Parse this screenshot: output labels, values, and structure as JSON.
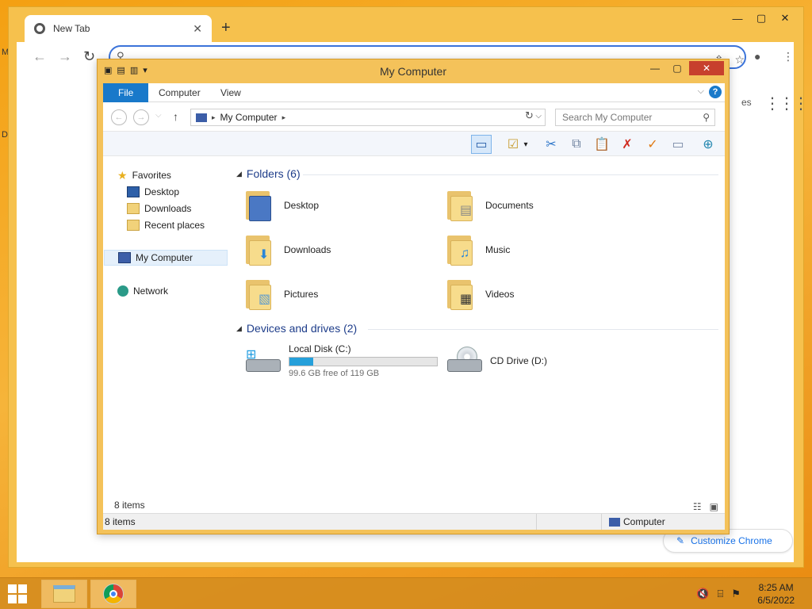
{
  "desktop": {
    "frag_m": "M",
    "frag_d": "D"
  },
  "chrome": {
    "tab_title": "New Tab",
    "tab_close": "✕",
    "new_tab": "+",
    "controls": [
      "—",
      "▢",
      "✕"
    ],
    "nav": {
      "back": "←",
      "forward": "→",
      "reload": "↻"
    },
    "omnibox_icons": [
      "⇪",
      "☆",
      "●",
      "⋮"
    ],
    "search_icon": "⚲",
    "content_fragment": "es",
    "apps_icon": "⋮⋮⋮",
    "customize_label": "Customize Chrome",
    "customize_icon": "✎"
  },
  "explorer": {
    "title": "My Computer",
    "quick_access": [
      "▣",
      "▤",
      "▥",
      "▾"
    ],
    "controls": {
      "minimize": "—",
      "maximize": "▢",
      "close": "✕"
    },
    "ribbon": {
      "tabs": [
        "File",
        "Computer",
        "View"
      ],
      "collapse": "⌵",
      "help": "?"
    },
    "address": {
      "back": "←",
      "forward": "→",
      "recent": "⌵",
      "up": "↑",
      "breadcrumb": "My Computer",
      "arrow": "▸",
      "dropdown": "⌵",
      "refresh": "↻",
      "search_placeholder": "Search My Computer",
      "search_icon": "⚲"
    },
    "commands": [
      "▭",
      "☑",
      "▾",
      "✂",
      "⧉",
      "📋",
      "✗",
      "✓",
      "▭",
      "⊕"
    ],
    "nav": {
      "favorites": "Favorites",
      "desktop": "Desktop",
      "downloads": "Downloads",
      "recent": "Recent places",
      "computer": "My Computer",
      "network": "Network"
    },
    "groups": {
      "folders": "Folders (6)",
      "devices": "Devices and drives (2)"
    },
    "folders": [
      {
        "name": "Desktop",
        "overlay": "▬"
      },
      {
        "name": "Documents",
        "overlay": "▤"
      },
      {
        "name": "Downloads",
        "overlay": "⬇"
      },
      {
        "name": "Music",
        "overlay": "♫"
      },
      {
        "name": "Pictures",
        "overlay": "▧"
      },
      {
        "name": "Videos",
        "overlay": "▦"
      }
    ],
    "drives": [
      {
        "name": "Local Disk (C:)",
        "free": "99.6 GB free of 119 GB",
        "used_fraction": 0.163
      },
      {
        "name": "CD Drive (D:)"
      }
    ],
    "status": {
      "items_inner": "8 items",
      "items_outer": "8 items",
      "location": "Computer",
      "view_icons": [
        "☷",
        "▣"
      ]
    }
  },
  "taskbar": {
    "time": "8:25 AM",
    "date": "6/5/2022",
    "tray_icons": [
      "🔇",
      "⌸",
      "⚑"
    ]
  },
  "colors": {
    "accent_blue": "#1979ca",
    "drive_bar": "#26a0da",
    "window_frame": "#f4c25a",
    "close_red": "#c7402d"
  }
}
